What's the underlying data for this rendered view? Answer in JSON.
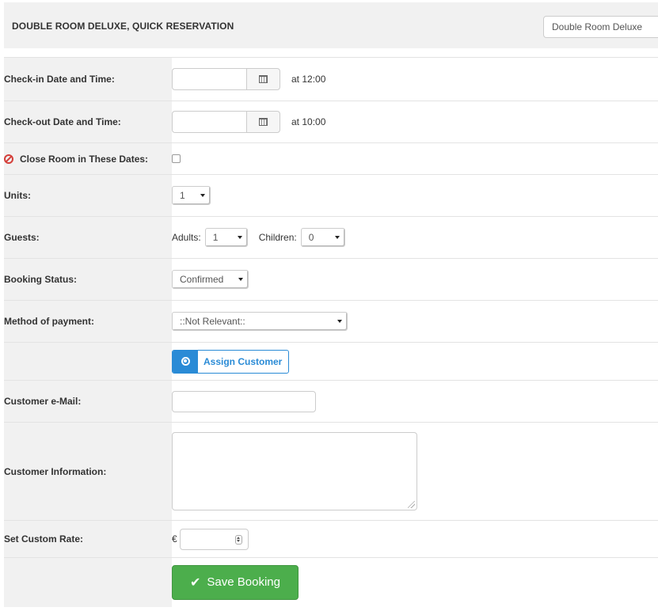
{
  "header": {
    "title": "DOUBLE ROOM DELUXE, QUICK RESERVATION",
    "room_select_value": "Double Room Deluxe"
  },
  "form": {
    "checkin_label": "Check-in Date and Time:",
    "checkin_time": "at 12:00",
    "checkout_label": "Check-out Date and Time:",
    "checkout_time": "at 10:00",
    "close_room_label": "Close Room in These Dates:",
    "units_label": "Units:",
    "units_value": "1",
    "guests_label": "Guests:",
    "adults_label": "Adults:",
    "adults_value": "1",
    "children_label": "Children:",
    "children_value": "0",
    "status_label": "Booking Status:",
    "status_value": "Confirmed",
    "payment_label": "Method of payment:",
    "payment_value": "::Not Relevant::",
    "assign_customer_label": "Assign Customer",
    "email_label": "Customer e-Mail:",
    "info_label": "Customer Information:",
    "rate_label": "Set Custom Rate:",
    "currency_symbol": "€",
    "save_label": "Save Booking"
  },
  "icons": {
    "calendar": "calendar-icon",
    "ban": "ban-icon",
    "user": "user-circle-icon",
    "check": "check-icon"
  },
  "colors": {
    "save_button": "#4cae4c",
    "assign_button": "#2a8bd6",
    "ban_icon": "#d43f3a",
    "label_bg": "#f1f1f1"
  }
}
